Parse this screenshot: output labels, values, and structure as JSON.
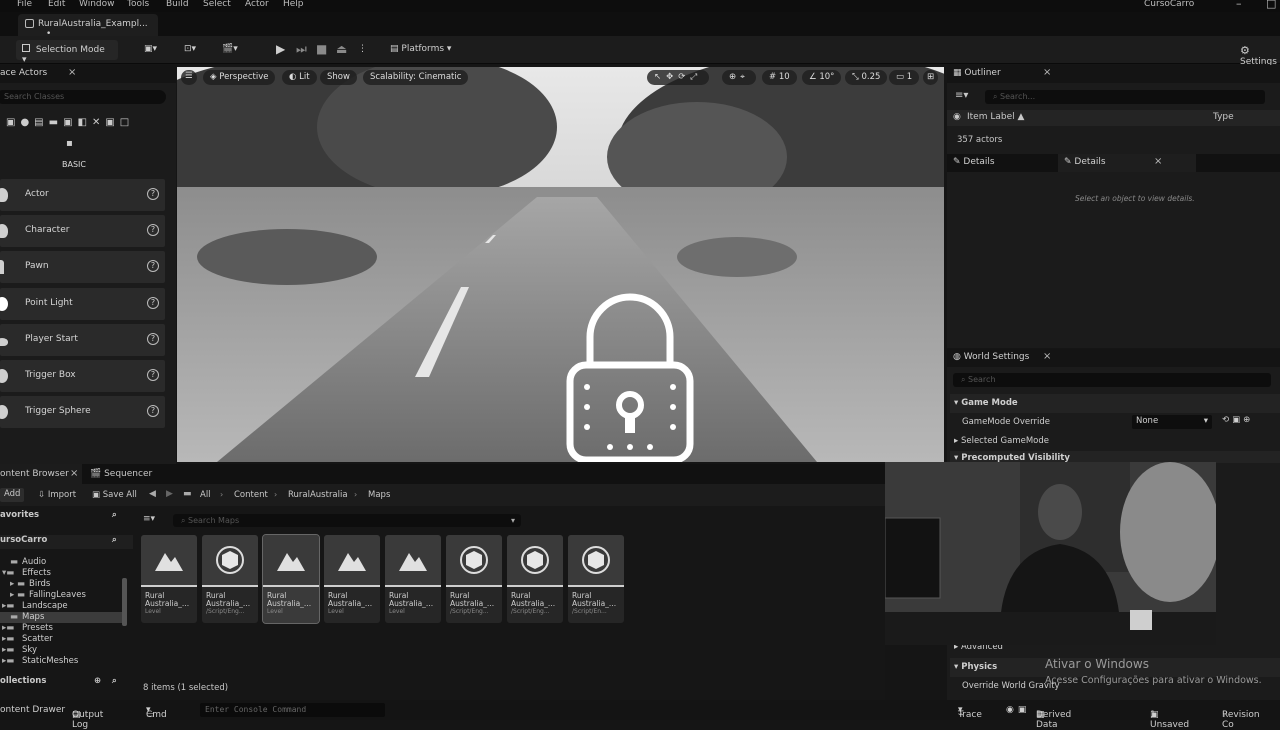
{
  "menu": [
    "File",
    "Edit",
    "Window",
    "Tools",
    "Build",
    "Select",
    "Actor",
    "Help"
  ],
  "project_name": "CursoCarro",
  "map_tab": "RuralAustralia_Exampl...",
  "map_tab_dot": "•",
  "toolbar": {
    "selection_mode": "Selection Mode",
    "platforms": "Platforms",
    "settings": "Settings"
  },
  "place_actors": {
    "title": "ace Actors",
    "search_placeholder": "Search Classes",
    "section": "BASIC",
    "items": [
      "Actor",
      "Character",
      "Pawn",
      "Point Light",
      "Player Start",
      "Trigger Box",
      "Trigger Sphere"
    ]
  },
  "viewport": {
    "perspective": "Perspective",
    "lit": "Lit",
    "show": "Show",
    "scalability": "Scalability: Cinematic",
    "grid_snap": "10",
    "rot_snap": "10°",
    "scale_snap": "0.25",
    "camera_speed": "1"
  },
  "outliner": {
    "title": "Outliner",
    "search_placeholder": "Search...",
    "col_label": "Item Label ▲",
    "col_type": "Type",
    "count": "357 actors"
  },
  "details": {
    "tab1": "Details",
    "tab2": "Details",
    "empty": "Select an object to view details."
  },
  "world_settings": {
    "title": "World Settings",
    "search_placeholder": "Search",
    "game_mode": "Game Mode",
    "gamemode_override": "GameMode Override",
    "gamemode_value": "None",
    "selected_gamemode": "Selected GameMode",
    "precomputed": "Precomputed Visibility",
    "advanced": "Advanced",
    "physics": "Physics",
    "override_gravity": "Override World Gravity"
  },
  "windows_watermark": {
    "title": "Ativar o Windows",
    "subtitle": "Acesse Configurações para ativar o Windows."
  },
  "content_browser": {
    "tab": "ontent Browser",
    "sequencer": "Sequencer",
    "add": "Add",
    "import": "Import",
    "save_all": "Save All",
    "breadcrumb": [
      "All",
      "Content",
      "RuralAustralia",
      "Maps"
    ],
    "search_placeholder": "Search Maps",
    "favorites": "avorites",
    "project": "ursoCarro",
    "collections": "ollections",
    "tree": [
      "Audio",
      "Effects",
      "Birds",
      "FallingLeaves",
      "Landscape",
      "Maps",
      "Presets",
      "Scatter",
      "Sky",
      "StaticMeshes"
    ],
    "status": "8 items (1 selected)",
    "assets": [
      {
        "n1": "Rural",
        "n2": "Australia_...",
        "t": "Level",
        "kind": "level"
      },
      {
        "n1": "Rural",
        "n2": "Australia_...",
        "t": "/Script/Eng...",
        "kind": "data"
      },
      {
        "n1": "Rural",
        "n2": "Australia_...",
        "t": "Level",
        "kind": "level"
      },
      {
        "n1": "Rural",
        "n2": "Australia_...",
        "t": "Level",
        "kind": "level"
      },
      {
        "n1": "Rural",
        "n2": "Australia_...",
        "t": "Level",
        "kind": "level"
      },
      {
        "n1": "Rural",
        "n2": "Australia_...",
        "t": "/Script/Eng...",
        "kind": "data"
      },
      {
        "n1": "Rural",
        "n2": "Australia_...",
        "t": "/Script/Eng...",
        "kind": "data"
      },
      {
        "n1": "Rural",
        "n2": "Australia_...",
        "t": "/Script/En...",
        "kind": "data"
      }
    ]
  },
  "statusbar": {
    "drawer": "ontent Drawer",
    "output_log": "Output Log",
    "cmd": "Cmd",
    "console_placeholder": "Enter Console Command",
    "trace": "Trace",
    "derived": "Derived Data",
    "unsaved": "1 Unsaved",
    "revision": "Revision Co"
  }
}
